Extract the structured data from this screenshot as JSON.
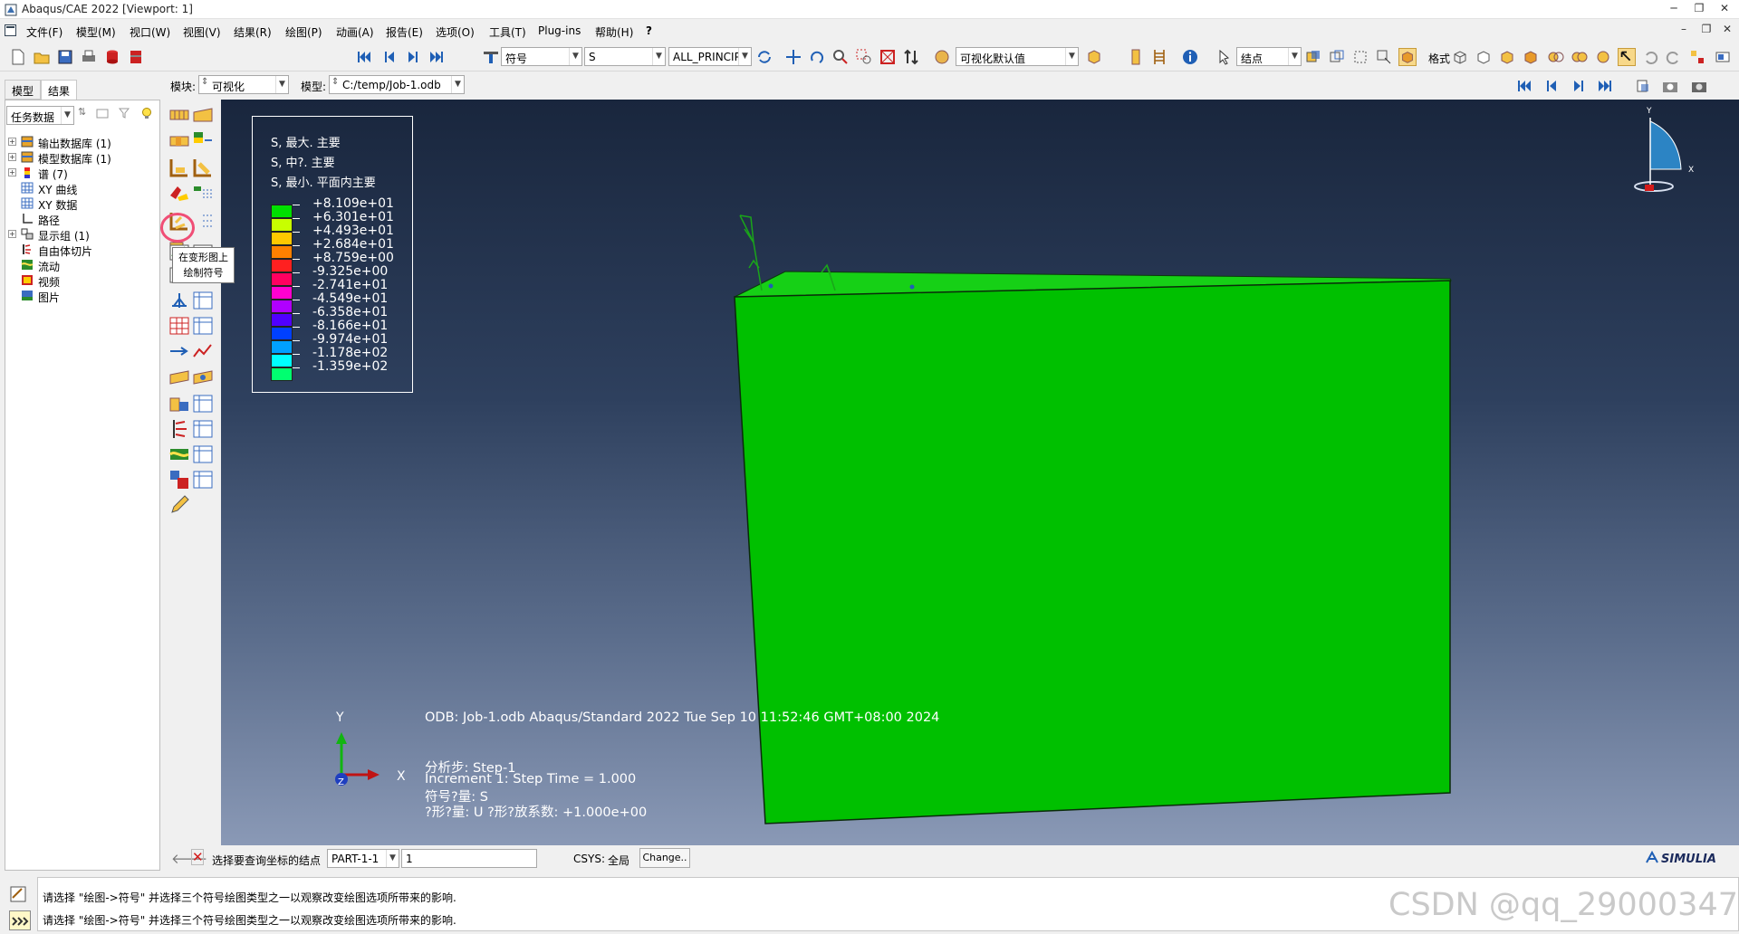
{
  "window": {
    "title": "Abaqus/CAE 2022 [Viewport: 1]"
  },
  "menu": [
    "文件(F)",
    "模型(M)",
    "视口(W)",
    "视图(V)",
    "结果(R)",
    "绘图(P)",
    "动画(A)",
    "报告(E)",
    "选项(O)",
    "工具(T)",
    "Plug-ins",
    "帮助(H)",
    "?"
  ],
  "toolbar": {
    "primary_var_type": "符号",
    "field_var": "S",
    "invariant": "ALL_PRINCIPAL",
    "render_style": "可视化默认值",
    "select_type": "结点",
    "label_button": "格式"
  },
  "context": {
    "module_label": "模块:",
    "module_value": "可视化",
    "model_label": "模型:",
    "model_value": "C:/temp/Job-1.odb"
  },
  "tabs": [
    "模型",
    "结果"
  ],
  "tree": {
    "filter": "任务数据",
    "items": [
      {
        "label": "输出数据库 (1)",
        "exp": "+"
      },
      {
        "label": "模型数据库 (1)",
        "exp": "+"
      },
      {
        "label": "谱 (7)",
        "exp": "+"
      },
      {
        "label": "XY 曲线",
        "exp": ""
      },
      {
        "label": "XY 数据",
        "exp": ""
      },
      {
        "label": "路径",
        "exp": ""
      },
      {
        "label": "显示组 (1)",
        "exp": "+"
      },
      {
        "label": "自由体切片",
        "exp": ""
      },
      {
        "label": "流动",
        "exp": ""
      },
      {
        "label": "视频",
        "exp": ""
      },
      {
        "label": "图片",
        "exp": ""
      }
    ]
  },
  "tooltip": {
    "line1": "在变形图上",
    "line2": "绘制符号"
  },
  "legend": {
    "headers": [
      "S, 最大. 主要",
      "S, 中?. 主要",
      "S, 最小. 平面内主要"
    ],
    "colors": [
      "#00e000",
      "#c8ff00",
      "#ffc800",
      "#ff8000",
      "#ff2020",
      "#ff0060",
      "#ff00d0",
      "#b000ff",
      "#5000ff",
      "#0040ff",
      "#00a0ff",
      "#00ffff",
      "#00ff70"
    ],
    "values": [
      "+8.109e+01",
      "+6.301e+01",
      "+4.493e+01",
      "+2.684e+01",
      "+8.759e+00",
      "-9.325e+00",
      "-2.741e+01",
      "-4.549e+01",
      "-6.358e+01",
      "-8.166e+01",
      "-9.974e+01",
      "-1.178e+02",
      "-1.359e+02"
    ]
  },
  "viewport_info": {
    "odb_line": "ODB: Job-1.odb    Abaqus/Standard 2022    Tue Sep 10 11:52:46 GMT+08:00 2024",
    "step_line": "分析步: Step-1",
    "increment_line": "Increment      1: Step Time =     1.000",
    "symbol_line": "符号?量: S",
    "deform_line": "?形?量: U   ?形?放系数: +1.000e+00"
  },
  "triad": {
    "x": "X",
    "y": "Y",
    "z": "Z"
  },
  "mini_triad": {
    "x": "X",
    "y": "Y"
  },
  "prompt": {
    "text": "选择要查询坐标的结点",
    "instance": "PART-1-1",
    "node_value": "1",
    "csys_label": "CSYS:",
    "csys_value": "全局",
    "change_button": "Change.."
  },
  "brand": "SIMULIA",
  "messages": [
    "请选择 \"绘图->符号\" 并选择三个符号绘图类型之一以观察改变绘图选项所带来的影响.",
    "请选择 \"绘图->符号\" 并选择三个符号绘图类型之一以观察改变绘图选项所带来的影响."
  ],
  "watermark": "CSDN @qq_29000347",
  "colors": {
    "part": "#00c000",
    "part_top": "#11d411",
    "accent": "#1f5fb5"
  }
}
